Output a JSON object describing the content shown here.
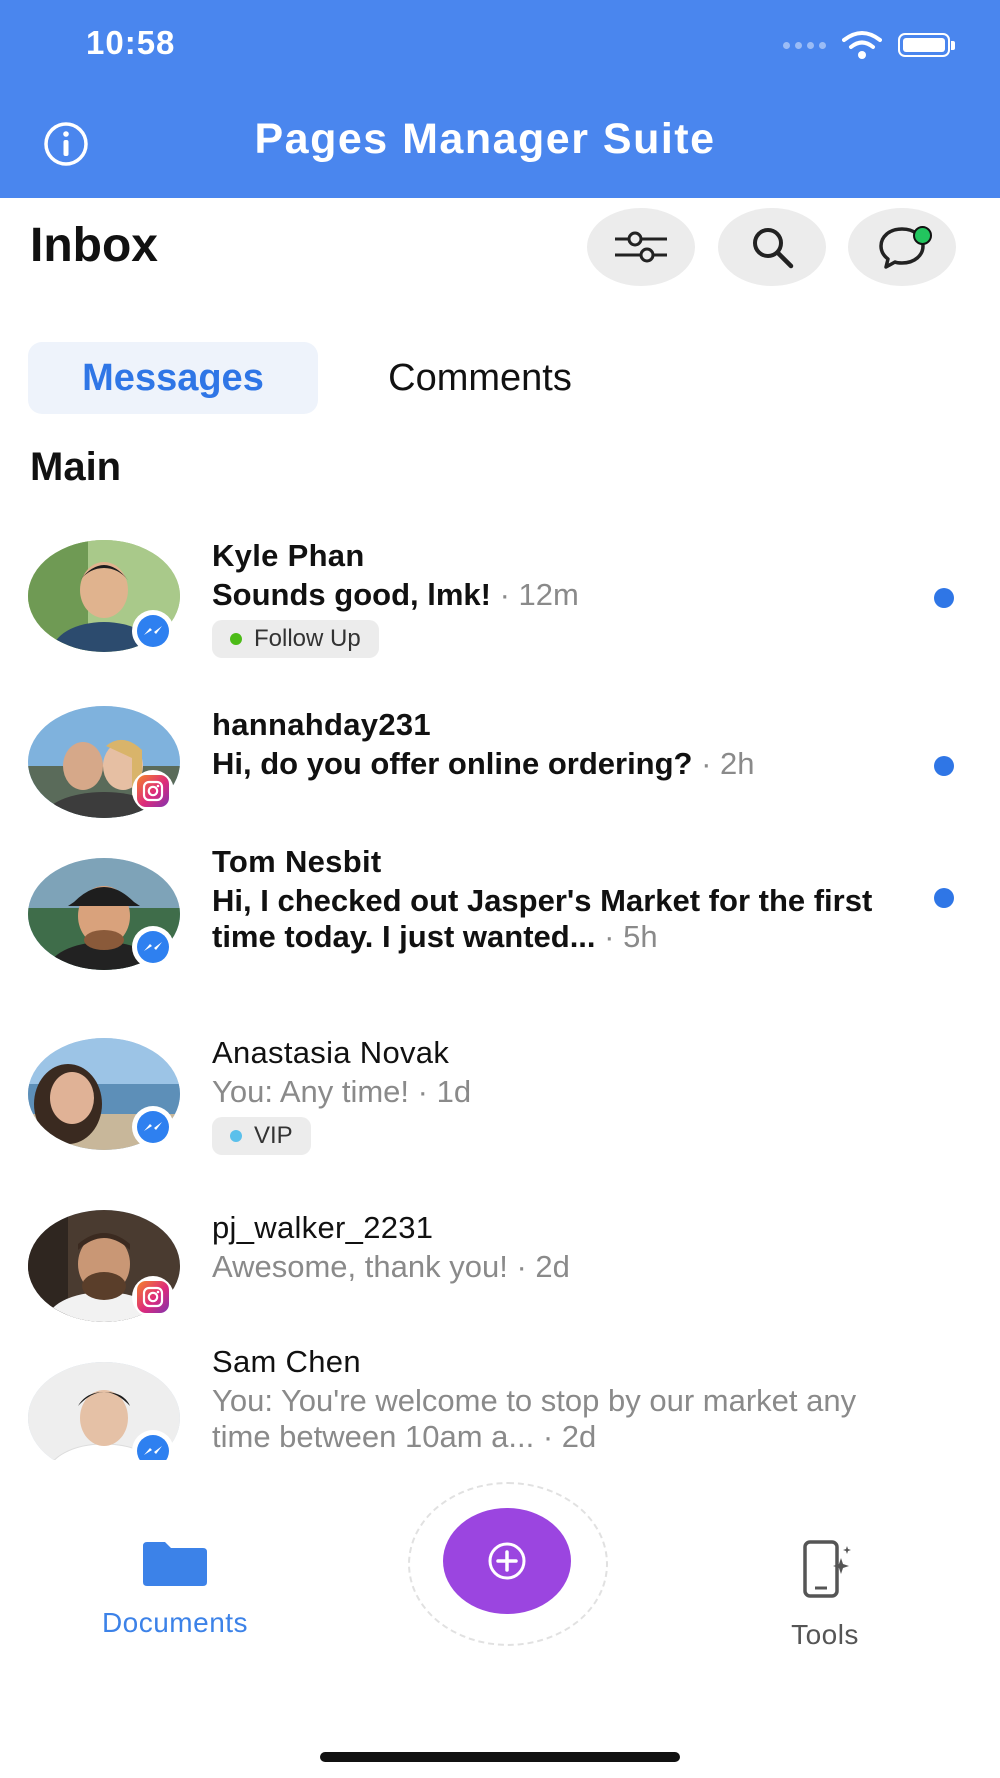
{
  "status_bar": {
    "time": "10:58"
  },
  "header": {
    "title": "Pages Manager Suite",
    "info_icon": "info-icon"
  },
  "inbox": {
    "title": "Inbox",
    "actions": {
      "filter_icon": "filter-icon",
      "search_icon": "search-icon",
      "compose_icon": "new-message-icon"
    }
  },
  "tabs": [
    {
      "label": "Messages",
      "active": true
    },
    {
      "label": "Comments",
      "active": false
    }
  ],
  "section": {
    "title": "Main"
  },
  "conversations": [
    {
      "name": "Kyle Phan",
      "message": "Sounds good, lmk!",
      "time": "· 12m",
      "unread": true,
      "platform": "messenger",
      "tag": "Follow Up",
      "tag_color": "#4cbb17"
    },
    {
      "name": "hannahday231",
      "message": "Hi, do you offer online ordering?",
      "time": "· 2h",
      "unread": true,
      "platform": "instagram"
    },
    {
      "name": "Tom Nesbit",
      "message": "Hi, I checked out Jasper's Market for the first time today. I just wanted...",
      "time": "· 5h",
      "unread": true,
      "platform": "messenger"
    },
    {
      "name": "Anastasia Novak",
      "message": "You: Any time!",
      "time": "· 1d",
      "unread": false,
      "platform": "messenger",
      "tag": "VIP",
      "tag_color": "#5bc0eb"
    },
    {
      "name": "pj_walker_2231",
      "message": "Awesome, thank you!",
      "time": "· 2d",
      "unread": false,
      "platform": "instagram"
    },
    {
      "name": "Sam Chen",
      "message": "You: You're welcome to stop by our market any time between 10am a...",
      "time": "· 2d",
      "unread": false,
      "platform": "messenger"
    }
  ],
  "bottom_nav": {
    "documents_label": "Documents",
    "tools_label": "Tools",
    "fab_icon": "plus-icon"
  },
  "colors": {
    "header": "#4a86ee",
    "accent": "#2f76e6",
    "fab": "#9b45e0"
  }
}
